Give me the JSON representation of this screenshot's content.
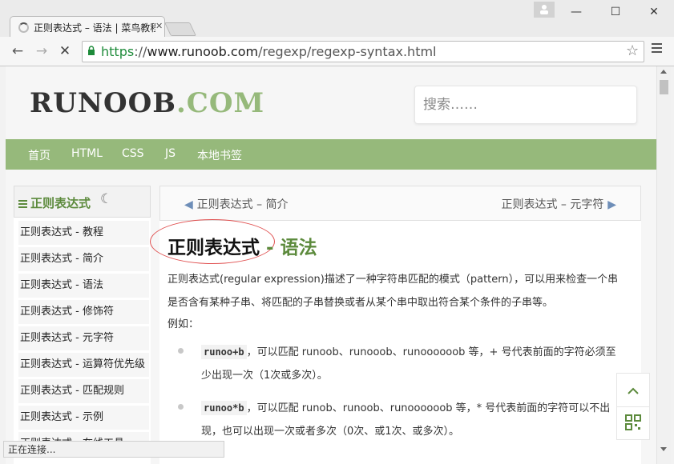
{
  "browser": {
    "tab_title": "正则表达式 – 语法 | 菜鸟教程",
    "url_scheme": "https",
    "url_rest": "://",
    "url_host": "www.runoob.com",
    "url_path": "/regexp/regexp-syntax.html",
    "status_text": "正在连接..."
  },
  "site": {
    "logo_main": "RUNOOB",
    "logo_domain": ".COM",
    "search_placeholder": "搜索……",
    "nav": [
      "首页",
      "HTML",
      "CSS",
      "JS",
      "本地书签"
    ],
    "brand_color": "#96b97b"
  },
  "sidebar": {
    "title": "正则表达式",
    "items": [
      "正则表达式 - 教程",
      "正则表达式 - 简介",
      "正则表达式 - 语法",
      "正则表达式 - 修饰符",
      "正则表达式 - 元字符",
      "正则表达式 - 运算符优先级",
      "正则表达式 - 匹配规则",
      "正则表达式 - 示例",
      "正则表达式 - 在线工具"
    ]
  },
  "article": {
    "prev": "正则表达式 – 简介",
    "next": "正则表达式 – 元字符",
    "title_main": "正则表达式",
    "title_sep": " - ",
    "title_sub": "语法",
    "intro": "正则表达式(regular expression)描述了一种字符串匹配的模式（pattern），可以用来检查一个串是否含有某种子串、将匹配的子串替换或者从某个串中取出符合某个条件的子串等。",
    "example_label": "例如：",
    "examples": [
      {
        "code": "runoo+b",
        "text": "，可以匹配 runoob、runooob、runoooooob 等，+ 号代表前面的字符必须至少出现一次（1次或多次）。"
      },
      {
        "code": "runoo*b",
        "text": "，可以匹配 runob、runoob、runoooooob 等，* 号代表前面的字符可以不出现，也可以出现一次或者多次（0次、或1次、或多次）。"
      }
    ]
  },
  "icons": {
    "back": "←",
    "forward": "→",
    "stop": "✕",
    "star": "☆",
    "moon": "☾",
    "prev_arrow": "🡄",
    "next_arrow": "🡆",
    "up": "︿",
    "minimize": "—",
    "maximize": "☐",
    "close": "✕"
  }
}
